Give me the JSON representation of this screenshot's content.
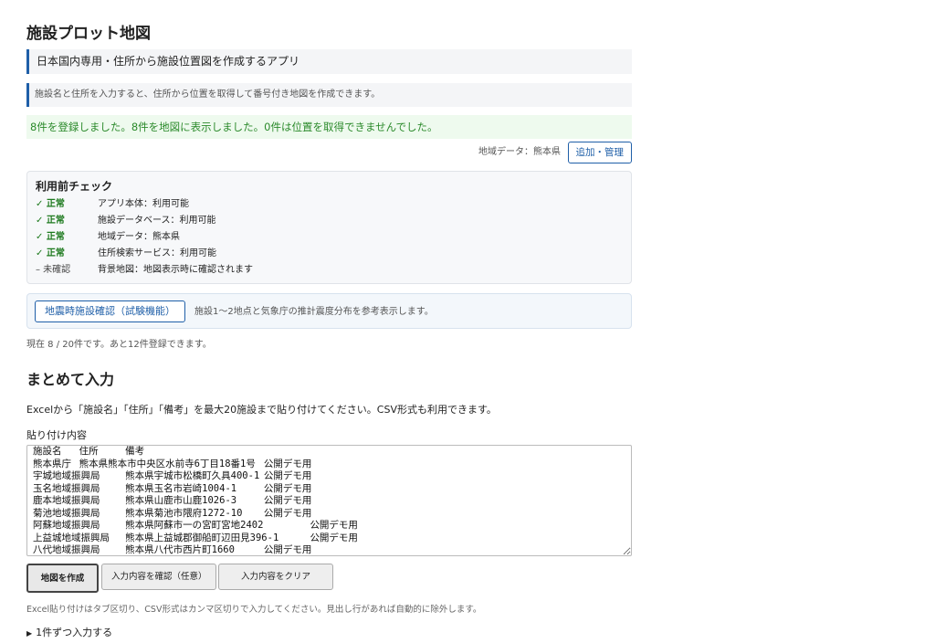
{
  "title": "施設プロット地図",
  "subtitle": "日本国内専用・住所から施設位置図を作成するアプリ",
  "info": "施設名と住所を入力すると、住所から位置を取得して番号付き地図を作成できます。",
  "success_message": "8件を登録しました。8件を地図に表示しました。0件は位置を取得できませんでした。",
  "region": {
    "label": "地域データ：熊本県",
    "manage_button": "追加・管理"
  },
  "precheck": {
    "title": "利用前チェック",
    "items": [
      {
        "status": "✓ 正常",
        "detail": "アプリ本体：利用可能"
      },
      {
        "status": "✓ 正常",
        "detail": "施設データベース：利用可能"
      },
      {
        "status": "✓ 正常",
        "detail": "地域データ：熊本県"
      },
      {
        "status": "✓ 正常",
        "detail": "住所検索サービス：利用可能"
      },
      {
        "status": "– 未確認",
        "detail": "背景地図：地図表示時に確認されます"
      }
    ]
  },
  "quake": {
    "button": "地震時施設確認（試験機能）",
    "note": "施設1〜2地点と気象庁の推計震度分布を参考表示します。"
  },
  "count_text": "現在 8 / 20件です。あと12件登録できます。",
  "bulk": {
    "heading": "まとめて入力",
    "description": "Excelから「施設名」「住所」「備考」を最大20施設まで貼り付けてください。CSV形式も利用できます。",
    "paste_label": "貼り付け内容",
    "paste_value": "施設名\t住所\t備考\n熊本県庁\t熊本県熊本市中央区水前寺6丁目18番1号\t公開デモ用\n宇城地域振興局\t熊本県宇城市松橋町久具400-1\t公開デモ用\n玉名地域振興局\t熊本県玉名市岩崎1004-1\t公開デモ用\n鹿本地域振興局\t熊本県山鹿市山鹿1026-3\t公開デモ用\n菊池地域振興局\t熊本県菊池市隈府1272-10\t公開デモ用\n阿蘇地域振興局\t熊本県阿蘇市一の宮町宮地2402\t公開デモ用\n上益城地域振興局\t熊本県上益城郡御船町辺田見396-1\t公開デモ用\n八代地域振興局\t熊本県八代市西片町1660\t公開デモ用",
    "create_button": "地図を作成",
    "confirm_button": "入力内容を確認（任意）",
    "clear_button": "入力内容をクリア",
    "hint": "Excel貼り付けはタブ区切り、CSV形式はカンマ区切りで入力してください。見出し行があれば自動的に除外します。"
  },
  "single_entry": "1件ずつ入力する"
}
